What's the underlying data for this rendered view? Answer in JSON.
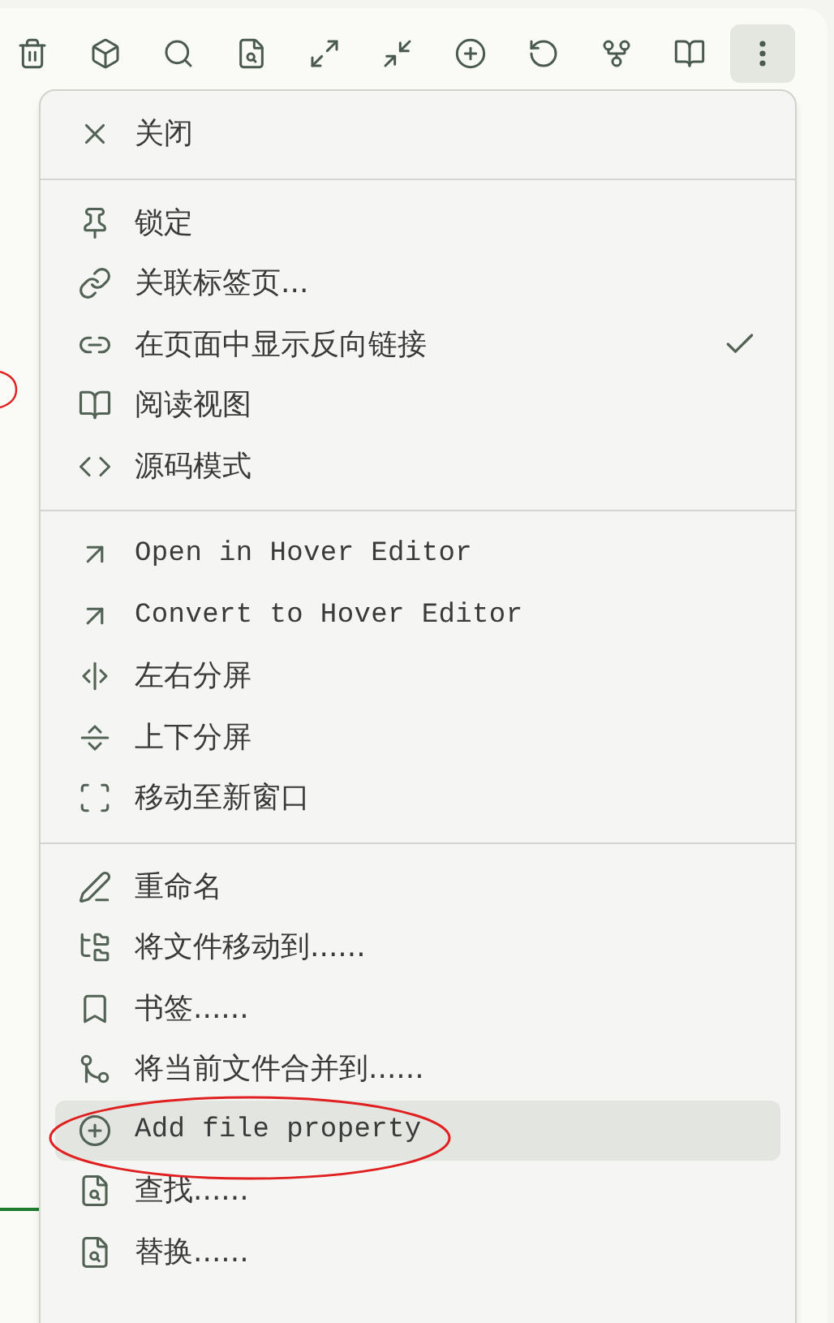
{
  "toolbar": {
    "buttons": [
      {
        "selected": false
      },
      {
        "selected": false
      },
      {
        "selected": false
      },
      {
        "selected": false
      },
      {
        "selected": false
      },
      {
        "selected": false
      },
      {
        "selected": false
      },
      {
        "selected": false
      },
      {
        "selected": false
      },
      {
        "selected": false
      },
      {
        "selected": true
      }
    ]
  },
  "menu": {
    "sections": [
      {
        "items": [
          {
            "label": "关闭",
            "kind": "cjk",
            "checked": false,
            "highlighted": false
          }
        ]
      },
      {
        "items": [
          {
            "label": "锁定",
            "kind": "cjk",
            "checked": false,
            "highlighted": false
          },
          {
            "label": "关联标签页...",
            "kind": "cjk",
            "checked": false,
            "highlighted": false
          },
          {
            "label": "在页面中显示反向链接",
            "kind": "cjk",
            "checked": true,
            "highlighted": false
          },
          {
            "label": "阅读视图",
            "kind": "cjk",
            "checked": false,
            "highlighted": false
          },
          {
            "label": "源码模式",
            "kind": "cjk",
            "checked": false,
            "highlighted": false
          }
        ]
      },
      {
        "items": [
          {
            "label": "Open in Hover Editor",
            "kind": "latin",
            "checked": false,
            "highlighted": false
          },
          {
            "label": "Convert to Hover Editor",
            "kind": "latin",
            "checked": false,
            "highlighted": false
          },
          {
            "label": "左右分屏",
            "kind": "cjk",
            "checked": false,
            "highlighted": false
          },
          {
            "label": "上下分屏",
            "kind": "cjk",
            "checked": false,
            "highlighted": false
          },
          {
            "label": "移动至新窗口",
            "kind": "cjk",
            "checked": false,
            "highlighted": false
          }
        ]
      },
      {
        "items": [
          {
            "label": "重命名",
            "kind": "cjk",
            "checked": false,
            "highlighted": false
          },
          {
            "label": "将文件移动到......",
            "kind": "cjk",
            "checked": false,
            "highlighted": false
          },
          {
            "label": "书签......",
            "kind": "cjk",
            "checked": false,
            "highlighted": false
          },
          {
            "label": "将当前文件合并到......",
            "kind": "cjk",
            "checked": false,
            "highlighted": false
          },
          {
            "label": "Add file property",
            "kind": "latin",
            "checked": false,
            "highlighted": true
          },
          {
            "label": "查找......",
            "kind": "cjk",
            "checked": false,
            "highlighted": false
          },
          {
            "label": "替换......",
            "kind": "cjk",
            "checked": false,
            "highlighted": false
          }
        ]
      }
    ]
  }
}
